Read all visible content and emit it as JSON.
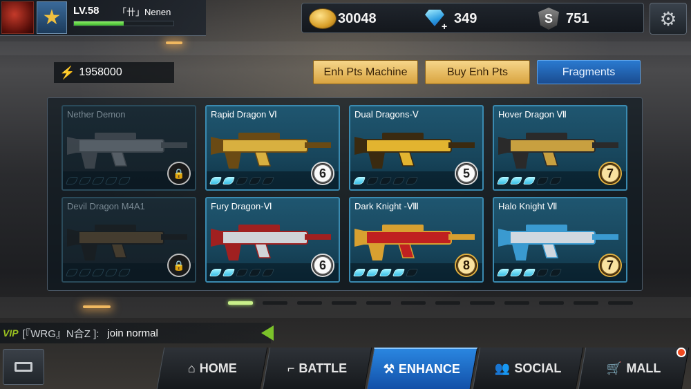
{
  "player": {
    "level": "LV.58",
    "name": "「卄」Nenen",
    "xp_fraction": 0.5
  },
  "currency": {
    "gold": "30048",
    "gems": "349",
    "s_points": "751"
  },
  "enhance_points": "1958000",
  "tabs": {
    "enh_pts_machine": "Enh Pts Machine",
    "buy_enh_pts": "Buy Enh Pts",
    "fragments": "Fragments"
  },
  "weapons": [
    {
      "name": "Nether Demon",
      "locked": true,
      "filled": 0,
      "total": 5,
      "stars": null
    },
    {
      "name": "Rapid Dragon Ⅵ",
      "locked": false,
      "filled": 2,
      "total": 5,
      "stars": "6"
    },
    {
      "name": "Dual Dragons-Ⅴ",
      "locked": false,
      "filled": 1,
      "total": 5,
      "stars": "5"
    },
    {
      "name": "Hover Dragon Ⅶ",
      "locked": false,
      "filled": 3,
      "total": 5,
      "stars": "7"
    },
    {
      "name": "Devil Dragon M4A1",
      "locked": true,
      "filled": 0,
      "total": 5,
      "stars": null
    },
    {
      "name": "Fury Dragon-Ⅵ",
      "locked": false,
      "filled": 2,
      "total": 5,
      "stars": "6"
    },
    {
      "name": "Dark Knight -Ⅷ",
      "locked": false,
      "filled": 4,
      "total": 5,
      "stars": "8"
    },
    {
      "name": "Halo Knight Ⅶ",
      "locked": false,
      "filled": 3,
      "total": 5,
      "stars": "7"
    }
  ],
  "pagination": {
    "current": 1,
    "total": 12
  },
  "chat": {
    "vip": "VIP",
    "channel": "[『WRG』N合Z ]:",
    "message": "join normal"
  },
  "nav": {
    "home": "HOME",
    "battle": "BATTLE",
    "enhance": "ENHANCE",
    "social": "SOCIAL",
    "mall": "MALL"
  },
  "colors": {
    "accent_blue": "#2a86e0",
    "gold_tab": "#f6d68a",
    "active_dot": "#9ef2ff",
    "vip_green": "#9ac020"
  }
}
